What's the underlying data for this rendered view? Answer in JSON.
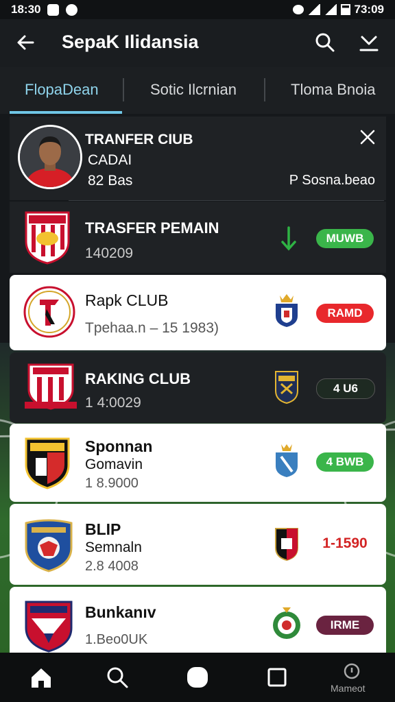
{
  "status": {
    "time_left": "18:30",
    "time_right": "73:09"
  },
  "appbar": {
    "title": "SepaK Ilidansia"
  },
  "tabs": [
    {
      "label": "FlopaDean",
      "active": true
    },
    {
      "label": "Sotic Ilcrnian",
      "active": false
    },
    {
      "label": "Tloma Bnoia",
      "active": false
    }
  ],
  "header_card": {
    "line1": "TRANFER CIUB",
    "line2": "CADAI",
    "line3": "82 Bas",
    "right_text": "P Sosna.beao"
  },
  "rows": [
    {
      "name": "TRASFER PEMAIN",
      "detail": "140209",
      "badge": "MUWB",
      "badge_color": "#3ab54a",
      "indicator": "green-arrow",
      "theme": "dark"
    },
    {
      "name": "Rapk CLUB",
      "detail": "Tpehaa.n – 15 1983)",
      "badge": "RAMD",
      "badge_color": "#e8282c",
      "theme": "light"
    },
    {
      "name": "RAKING CLUB",
      "detail": "1 4:0029",
      "badge": "4 U6",
      "badge_color": "#1e2a22",
      "theme": "dark"
    },
    {
      "name": "Sponnan",
      "name2": "Gomavin",
      "detail": "1 8.9000",
      "badge": "4 BWB",
      "badge_color": "#3ab54a",
      "theme": "light"
    },
    {
      "name": "BLIP",
      "name2": "Semnaln",
      "detail": "2.8 4008",
      "badge": "1-1590",
      "badge_color": "#d32424",
      "theme": "light"
    },
    {
      "name": "Bunkanıv",
      "detail": "1.Beo0UK",
      "badge": "IRME",
      "badge_color": "#6a2340",
      "theme": "light"
    }
  ],
  "bottom_nav": {
    "last_label": "Mameot"
  }
}
